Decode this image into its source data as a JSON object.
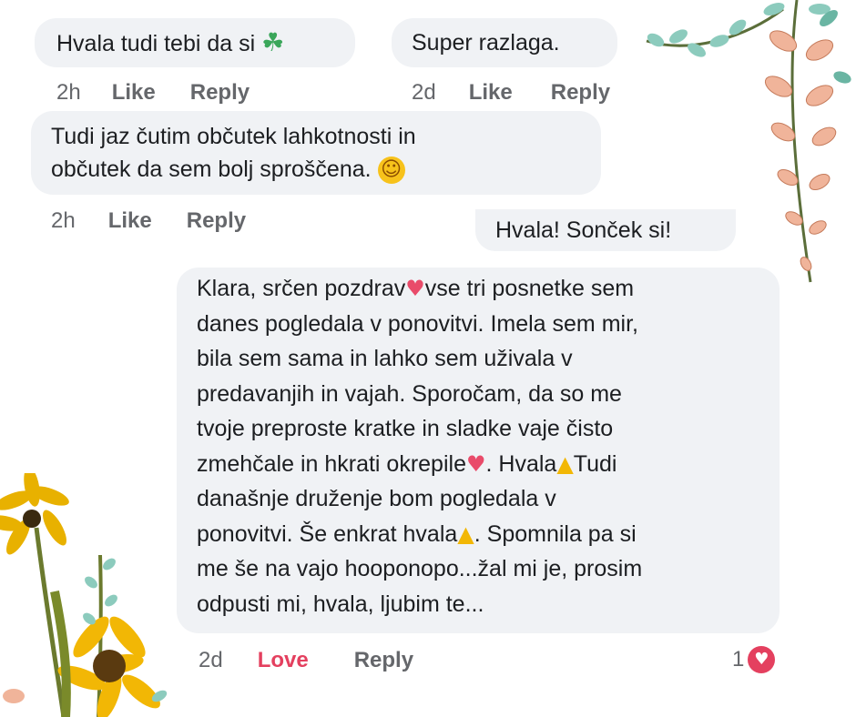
{
  "comments": [
    {
      "text": "Hvala tudi tebi da si",
      "emoji": "☘",
      "time": "2h",
      "like": "Like",
      "reply": "Reply"
    },
    {
      "text": "Super razlaga.",
      "time": "2d",
      "like": "Like",
      "reply": "Reply"
    },
    {
      "line1": "Tudi jaz čutim občutek lahkotnosti in",
      "line2": "občutek da sem bolj sproščena.",
      "emoji": "☺",
      "time": "2h",
      "like": "Like",
      "reply": "Reply"
    },
    {
      "text": "Hvala! Sonček si!"
    },
    {
      "lines": [
        "Klara, srčen pozdrav",
        "vse tri posnetke sem",
        "danes pogledala v ponovitvi. Imela sem mir,",
        "bila sem sama in lahko sem uživala v",
        "predavanjih in vajah. Sporočam, da so me",
        "tvoje preproste kratke in sladke vaje čisto",
        "zmehčale in hkrati okrepile",
        ". Hvala",
        "Tudi",
        "današnje druženje bom pogledala v",
        "ponovitvi. Še enkrat hvala",
        ". Spomnila pa si",
        "me še na vajo hooponopo...žal mi je, prosim",
        "odpusti mi, hvala, ljubim te..."
      ],
      "time": "2d",
      "love": "Love",
      "reply": "Reply",
      "reaction_count": "1"
    }
  ],
  "colors": {
    "bubble": "#f0f2f5",
    "meta": "#65676b",
    "love": "#e4405f"
  },
  "icons": [
    "shamrock-icon",
    "smiling-face-icon",
    "smiling-face-hearts-icon",
    "folded-hands-icon",
    "heart-reaction-icon",
    "flower-decoration"
  ]
}
